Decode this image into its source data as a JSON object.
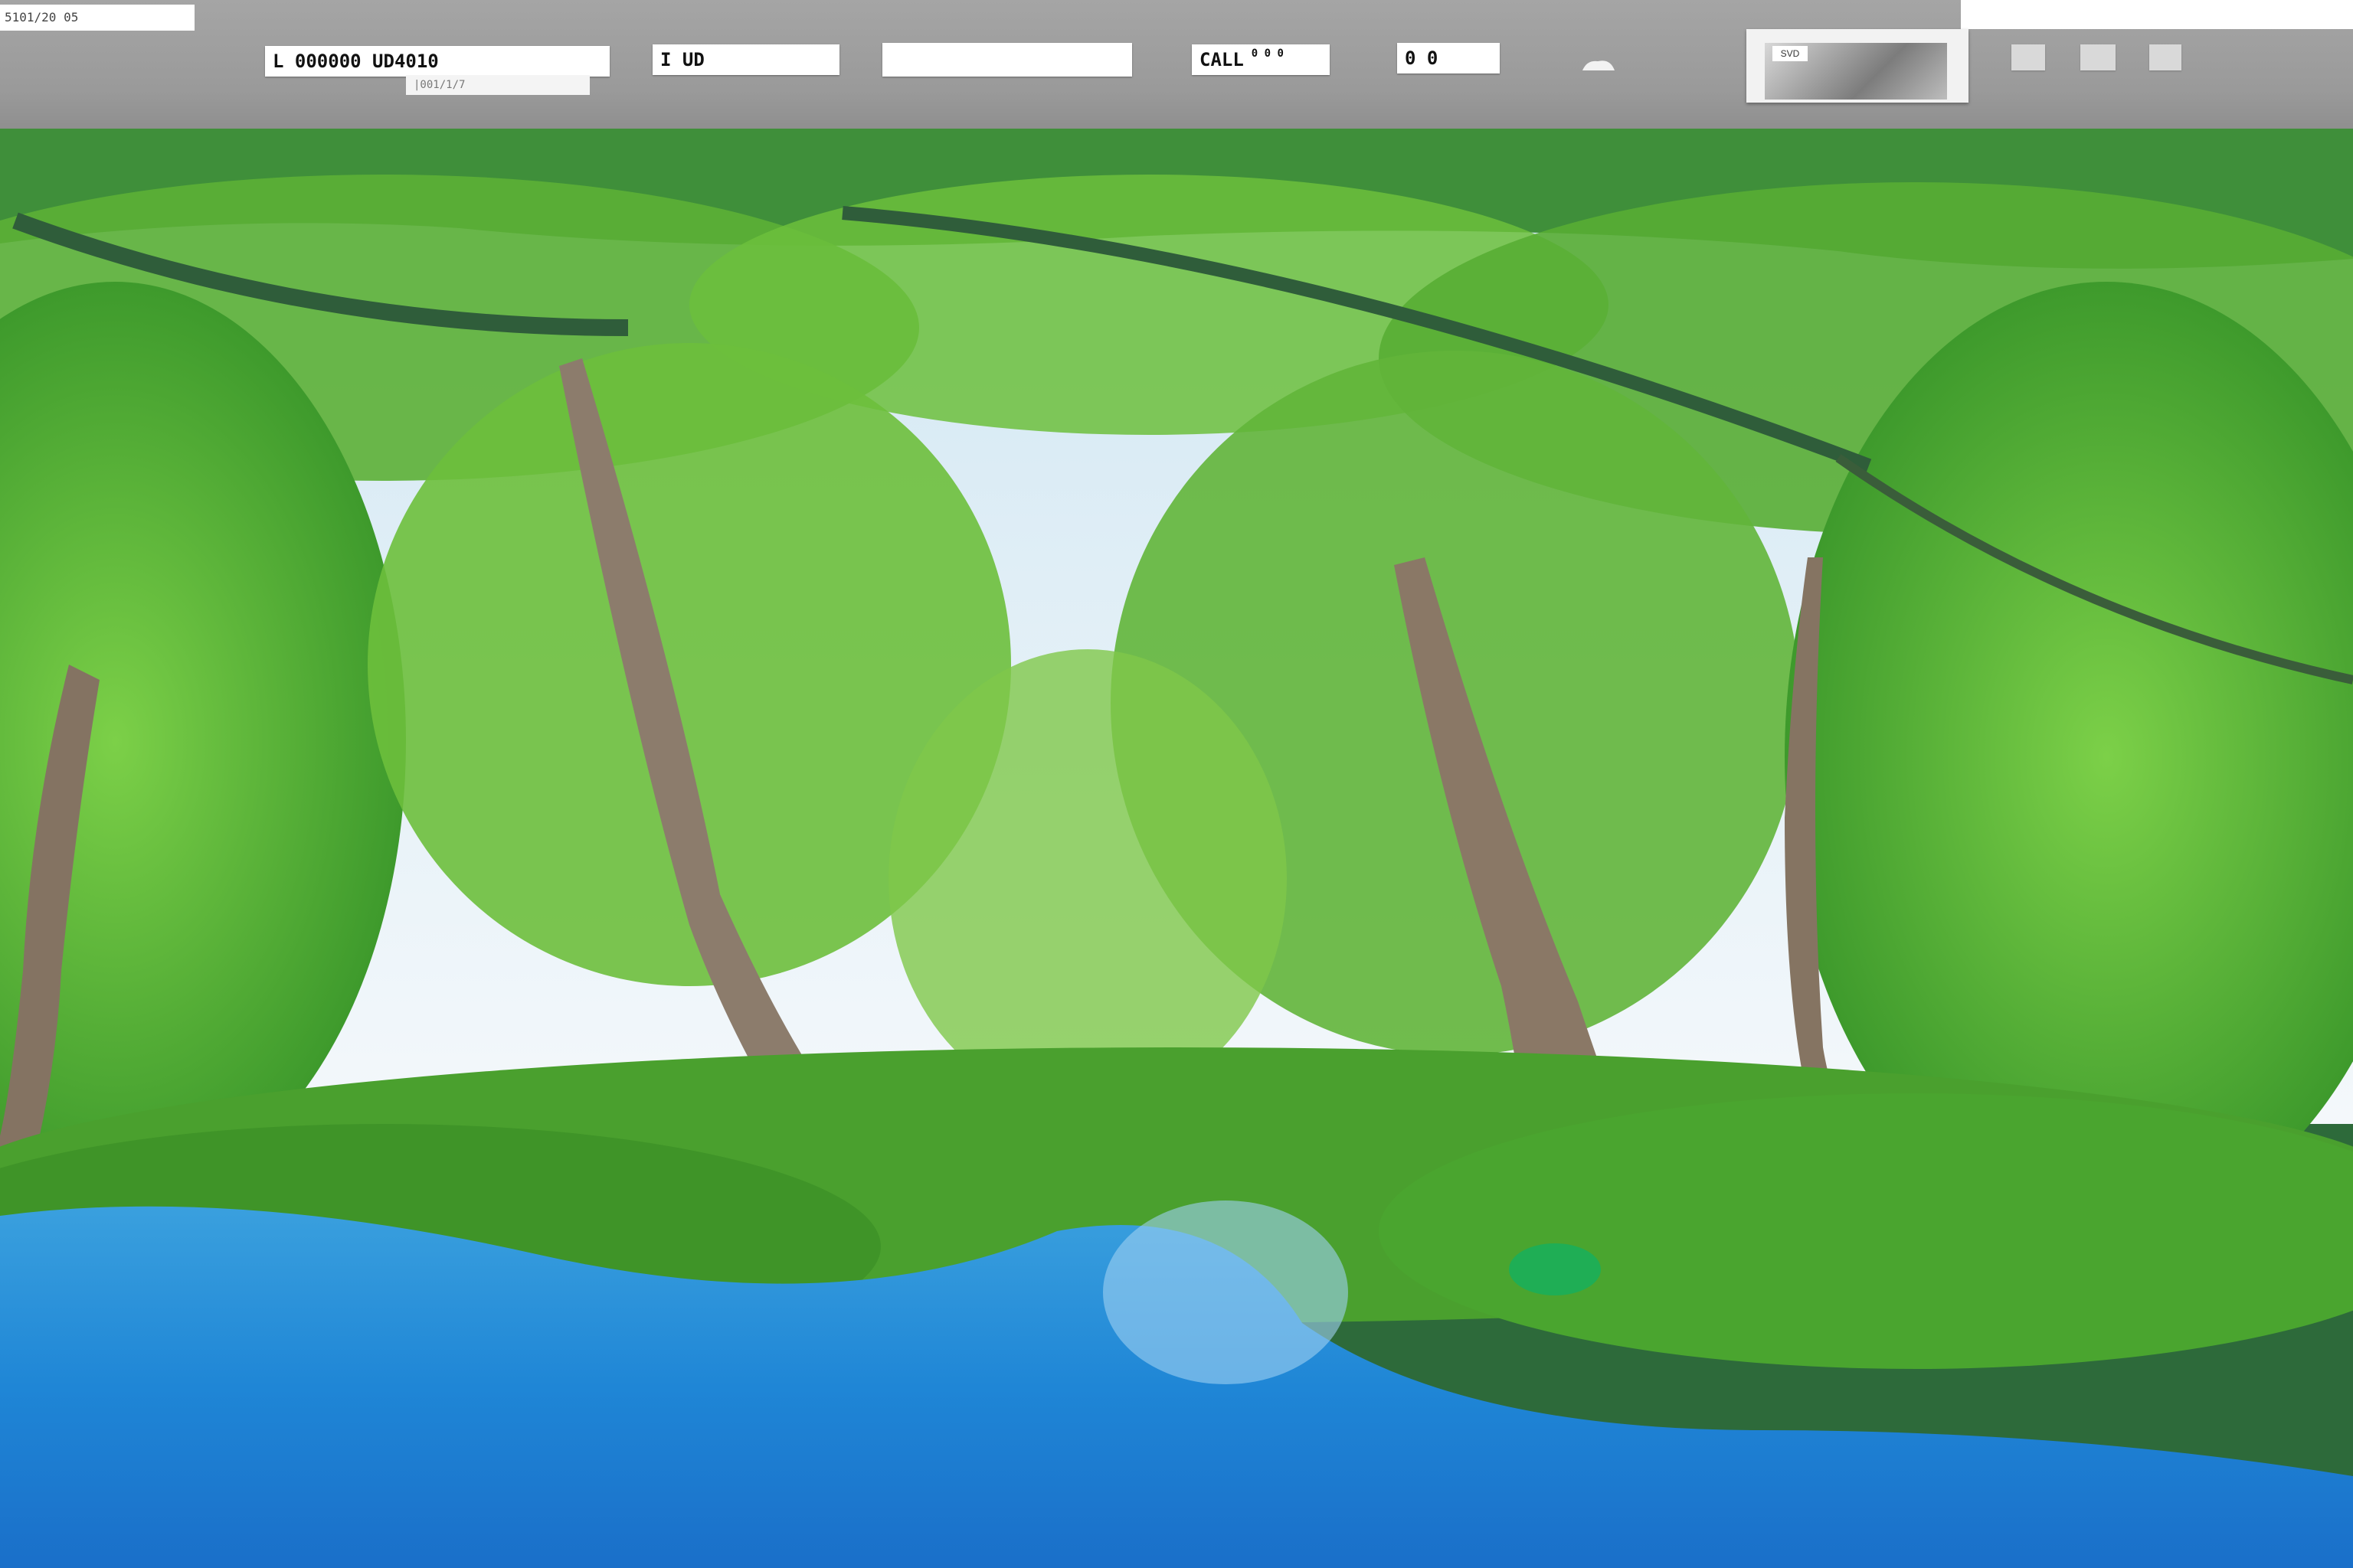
{
  "toolbar": {
    "corner_label": "5101/20 05",
    "field_coordinates": "L  000000   UD4010",
    "field_coordinates_sub": "|001/1/7",
    "field_b": "I  UD",
    "field_c": "",
    "field_d": "CALL",
    "field_d_suffix": "0 0 0",
    "field_e": "0  0",
    "preview_tag": "SVD"
  },
  "icons": {
    "cloud": "cloud-icon",
    "preview": "preview-thumbnail-icon"
  },
  "colors": {
    "toolbar_bg": "#9e9e9e",
    "foliage": "#5fb833",
    "water": "#2a8fd8",
    "trunk": "#8a7a6a"
  }
}
